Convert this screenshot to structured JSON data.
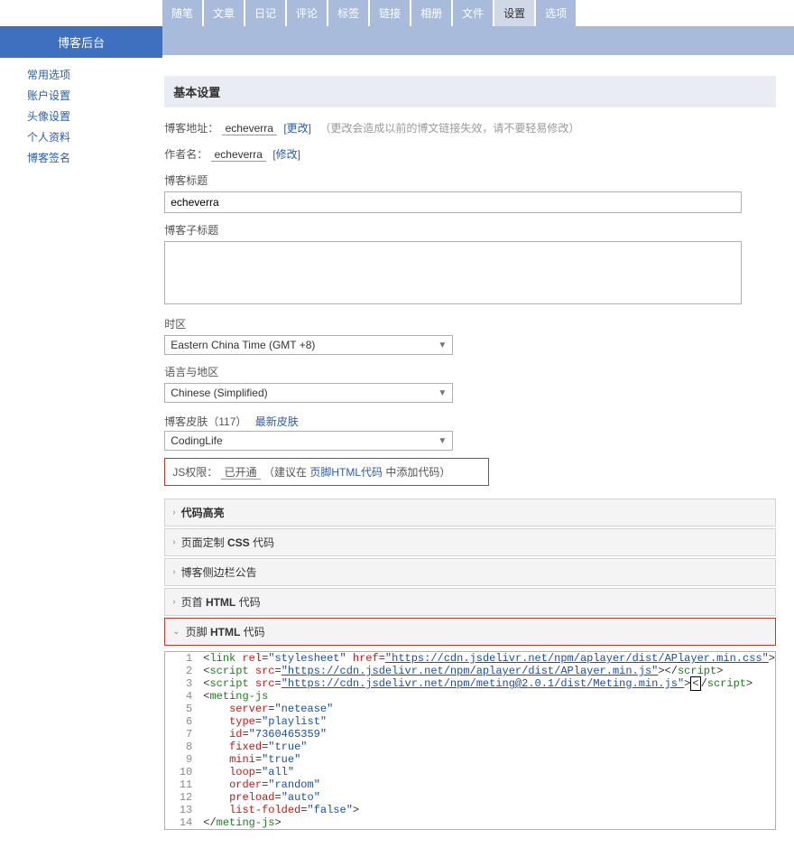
{
  "tabs": [
    "随笔",
    "文章",
    "日记",
    "评论",
    "标签",
    "链接",
    "相册",
    "文件",
    "设置",
    "选项"
  ],
  "tabs_active_index": 8,
  "sidebar_title": "博客后台",
  "sidebar_links": [
    "常用选项",
    "账户设置",
    "头像设置",
    "个人资料",
    "博客签名"
  ],
  "section_title": "基本设置",
  "blog_addr_label": "博客地址：",
  "blog_addr_value": "echeverra",
  "blog_addr_change": "[更改]",
  "blog_addr_hint": "（更改会造成以前的博文链接失效，请不要轻易修改）",
  "author_label": "作者名：",
  "author_value": "echeverra",
  "author_change": "[修改]",
  "title_label": "博客标题",
  "title_value": "echeverra",
  "subtitle_label": "博客子标题",
  "subtitle_value": "",
  "tz_label": "时区",
  "tz_value": "Eastern China Time (GMT +8)",
  "lang_label": "语言与地区",
  "lang_value": "Chinese (Simplified)",
  "skin_prefix": "博客皮肤（117）",
  "skin_latest": "最新皮肤",
  "skin_value": "CodingLife",
  "js_label": "JS权限：",
  "js_status": "已开通",
  "js_hint_a": "（建议在",
  "js_hint_link": "页脚HTML代码",
  "js_hint_b": "中添加代码）",
  "acc_items": [
    "代码高亮",
    "页面定制 CSS 代码",
    "博客侧边栏公告",
    "页首 HTML 代码",
    "页脚 HTML 代码"
  ],
  "code_lines": [
    {
      "n": "1",
      "html": "<span class='tok-punct'>&lt;</span><span class='tok-tag'>link</span> <span class='tok-attr'>rel</span>=<span class='tok-strn'>\"stylesheet\"</span> <span class='tok-attr'>href</span>=<span class='tok-str'>\"https://cdn.jsdelivr.net/npm/aplayer/dist/APlayer.min.css\"</span><span class='tok-punct'>&gt;</span>"
    },
    {
      "n": "2",
      "html": "<span class='tok-punct'>&lt;</span><span class='tok-tag'>script</span> <span class='tok-attr'>src</span>=<span class='tok-str'>\"https://cdn.jsdelivr.net/npm/aplayer/dist/APlayer.min.js\"</span><span class='tok-punct'>&gt;&lt;/</span><span class='tok-tag'>script</span><span class='tok-punct'>&gt;</span>"
    },
    {
      "n": "3",
      "html": "<span class='tok-punct'>&lt;</span><span class='tok-tag'>script</span> <span class='tok-attr'>src</span>=<span class='tok-str'>\"https://cdn.jsdelivr.net/npm/meting@2.0.1/dist/Meting.min.js\"</span><span class='tok-punct'>&gt;</span><span class='cursor'>&lt;</span><span class='tok-punct'>/</span><span class='tok-tag'>script</span><span class='tok-punct'>&gt;</span>"
    },
    {
      "n": "4",
      "html": "<span class='tok-punct'>&lt;</span><span class='tok-tag'>meting-js</span>"
    },
    {
      "n": "5",
      "html": "    <span class='tok-attr'>server</span>=<span class='tok-strn'>\"netease\"</span>"
    },
    {
      "n": "6",
      "html": "    <span class='tok-attr'>type</span>=<span class='tok-strn'>\"playlist\"</span>"
    },
    {
      "n": "7",
      "html": "    <span class='tok-attr'>id</span>=<span class='tok-strn'>\"7360465359\"</span>"
    },
    {
      "n": "8",
      "html": "    <span class='tok-attr'>fixed</span>=<span class='tok-strn'>\"true\"</span>"
    },
    {
      "n": "9",
      "html": "    <span class='tok-attr'>mini</span>=<span class='tok-strn'>\"true\"</span>"
    },
    {
      "n": "10",
      "html": "    <span class='tok-attr'>loop</span>=<span class='tok-strn'>\"all\"</span>"
    },
    {
      "n": "11",
      "html": "    <span class='tok-attr'>order</span>=<span class='tok-strn'>\"random\"</span>"
    },
    {
      "n": "12",
      "html": "    <span class='tok-attr'>preload</span>=<span class='tok-strn'>\"auto\"</span>"
    },
    {
      "n": "13",
      "html": "    <span class='tok-attr'>list-folded</span>=<span class='tok-strn'>\"false\"</span><span class='tok-punct'>&gt;</span>"
    },
    {
      "n": "14",
      "html": "<span class='tok-punct'>&lt;/</span><span class='tok-tag'>meting-js</span><span class='tok-punct'>&gt;</span>"
    }
  ]
}
